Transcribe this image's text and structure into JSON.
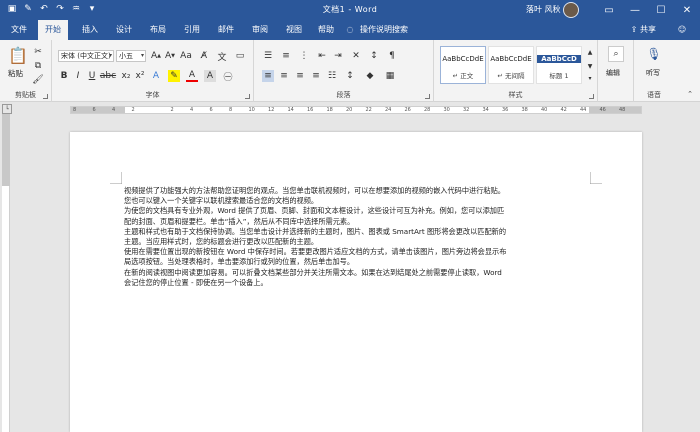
{
  "titlebar": {
    "title": "文档1  -  Word",
    "user": "落叶 风秋",
    "qa_icons": [
      "save-icon",
      "autosave-icon",
      "undo-icon",
      "redo-icon",
      "paint-icon",
      "customize-icon"
    ]
  },
  "tabs": [
    "文件",
    "开始",
    "插入",
    "设计",
    "布局",
    "引用",
    "邮件",
    "审阅",
    "视图",
    "帮助"
  ],
  "tell_me": "操作说明搜索",
  "share": "共享",
  "ribbon": {
    "clipboard": {
      "paste": "粘贴",
      "label": "剪贴板"
    },
    "font": {
      "name": "宋体 (中文正文)",
      "size": "小五",
      "label": "字体"
    },
    "paragraph": {
      "label": "段落"
    },
    "styles": {
      "label": "样式",
      "items": [
        {
          "sample": "AaBbCcDdE",
          "name": "↵ 正文"
        },
        {
          "sample": "AaBbCcDdE",
          "name": "↵ 无间隔"
        },
        {
          "sample": "AaBbCcD",
          "name": "标题 1"
        }
      ]
    },
    "editing": {
      "label": "编辑"
    },
    "voice": {
      "dictate": "听写",
      "label": "语音"
    }
  },
  "ruler_numbers": [
    "8",
    "6",
    "4",
    "2",
    "",
    "2",
    "4",
    "6",
    "8",
    "10",
    "12",
    "14",
    "16",
    "18",
    "20",
    "22",
    "24",
    "26",
    "28",
    "30",
    "32",
    "34",
    "36",
    "38",
    "40",
    "42",
    "44",
    "46",
    "48"
  ],
  "document": {
    "lines": [
      "视频提供了功能强大的方法帮助您证明您的观点。当您单击联机视频时，可以在想要添加的视频的嵌入代码中进行粘贴。",
      "您也可以键入一个关键字以联机搜索最适合您的文档的视频。",
      "为使您的文档具有专业外观，Word 提供了页眉、页脚、封面和文本框设计，这些设计可互为补充。例如，您可以添加匹",
      "配的封面、页眉和提要栏。单击“插入”，然后从不同库中选择所需元素。",
      "主题和样式也有助于文档保持协调。当您单击设计并选择新的主题时，图片、图表或 SmartArt 图形将会更改以匹配新的",
      "主题。当应用样式时，您的标题会进行更改以匹配新的主题。",
      "使用在需要位置出现的新按钮在 Word 中保存时间。若要更改图片适应文档的方式，请单击该图片，图片旁边将会显示布",
      "局选项按钮。当处理表格时，单击要添加行或列的位置，然后单击加号。",
      "在新的阅读视图中阅读更加容易。可以折叠文档某些部分并关注所需文本。如果在达到结尾处之前需要停止读取，Word",
      "会记住您的停止位置 - 即使在另一个设备上。"
    ]
  }
}
